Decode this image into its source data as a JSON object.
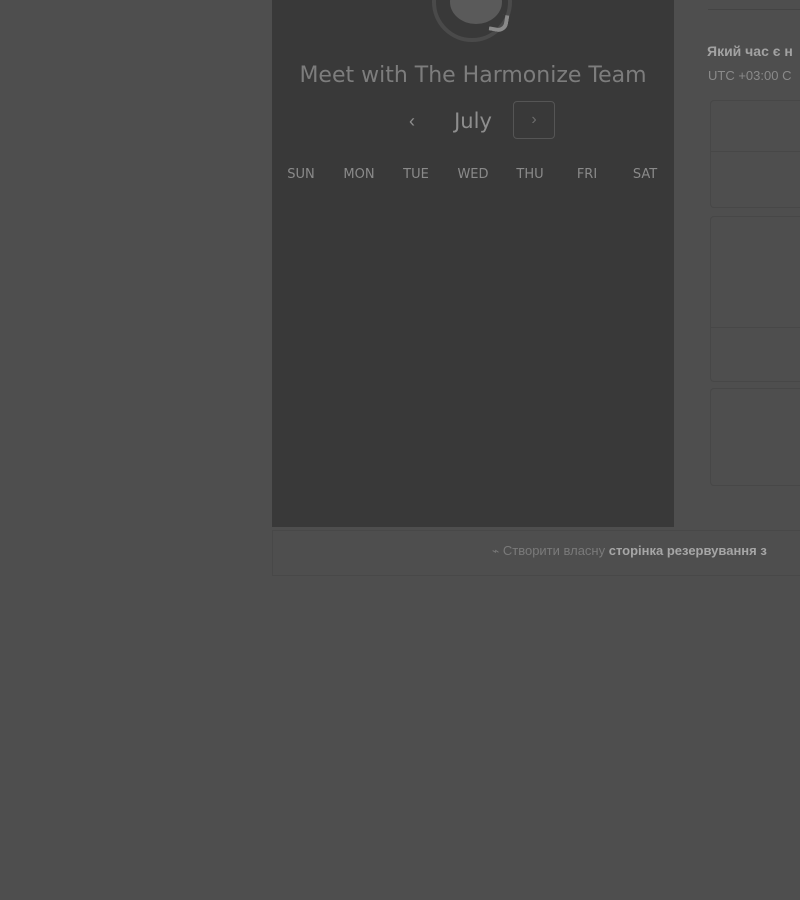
{
  "header": {
    "logo_icon": "chat-bubble-icon",
    "logo_dots": "•••",
    "title": "Meet with The Harmonize Team"
  },
  "calendar": {
    "month": "July",
    "prev_glyph": "‹",
    "next_glyph": "›",
    "weekdays": [
      "SUN",
      "MON",
      "TUE",
      "WED",
      "THU",
      "FRI",
      "SAT"
    ]
  },
  "times": {
    "question": "Який час є н",
    "timezone": "UTC +03:00 С"
  },
  "footer": {
    "icon_glyph": "⌁",
    "prefix": "Створити власну",
    "link": "сторінка резервування з"
  }
}
